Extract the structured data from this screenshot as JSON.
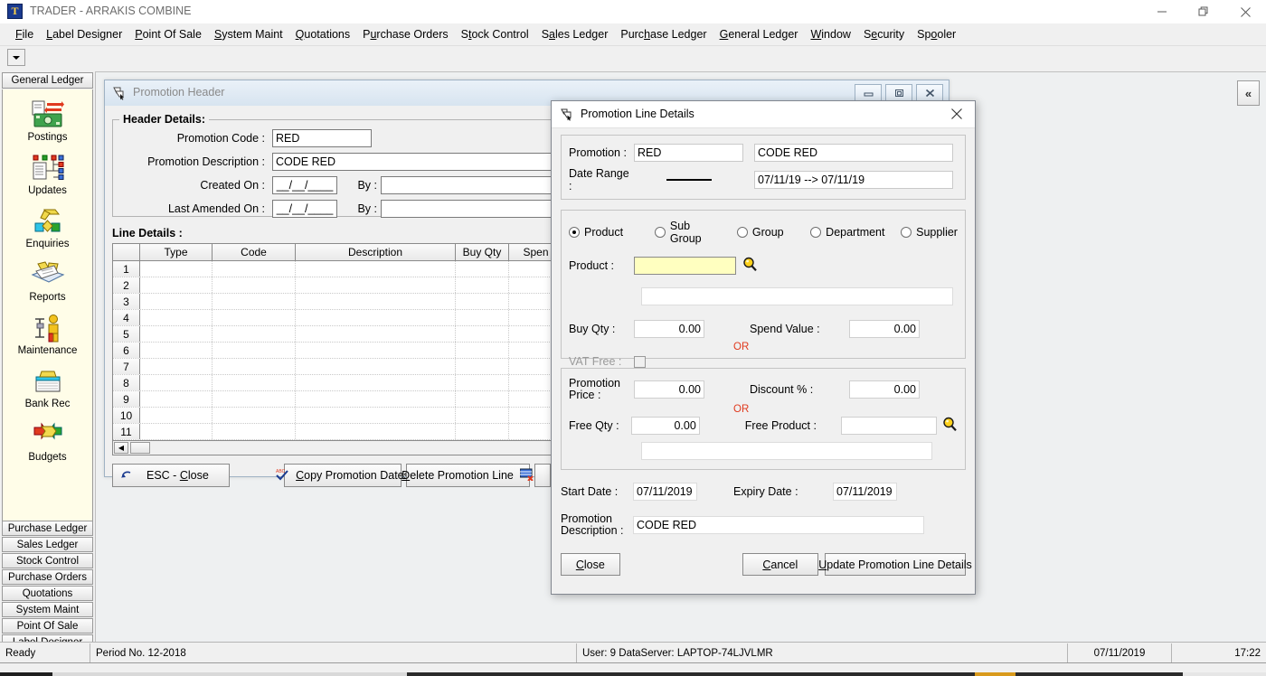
{
  "window": {
    "title": "TRADER - ARRAKIS COMBINE",
    "icon": "trader-app-icon",
    "minimize": "minimize-icon",
    "maximize": "restore-icon",
    "close": "close-icon"
  },
  "menubar": {
    "items": [
      {
        "label": "File",
        "accel": "F"
      },
      {
        "label": "Label Designer",
        "accel": "L"
      },
      {
        "label": "Point Of Sale",
        "accel": "P"
      },
      {
        "label": "System Maint",
        "accel": "S"
      },
      {
        "label": "Quotations",
        "accel": "Q"
      },
      {
        "label": "Purchase Orders",
        "accel": "u"
      },
      {
        "label": "Stock Control",
        "accel": "t"
      },
      {
        "label": "Sales Ledger",
        "accel": "a"
      },
      {
        "label": "Purchase Ledger",
        "accel": "h"
      },
      {
        "label": "General Ledger",
        "accel": "G"
      },
      {
        "label": "Window",
        "accel": "W"
      },
      {
        "label": "Security",
        "accel": "e"
      },
      {
        "label": "Spooler",
        "accel": "o"
      }
    ]
  },
  "sidebar": {
    "active_tab": "General Ledger",
    "entries": [
      {
        "label": "Postings",
        "icon": "postings-icon"
      },
      {
        "label": "Updates",
        "icon": "updates-icon"
      },
      {
        "label": "Enquiries",
        "icon": "enquiries-icon"
      },
      {
        "label": "Reports",
        "icon": "reports-icon"
      },
      {
        "label": "Maintenance",
        "icon": "maintenance-icon"
      },
      {
        "label": "Bank Rec",
        "icon": "bank-rec-icon"
      },
      {
        "label": "Budgets",
        "icon": "budgets-icon"
      }
    ],
    "bottom_tabs": [
      "Purchase Ledger",
      "Sales Ledger",
      "Stock Control",
      "Purchase Orders",
      "Quotations",
      "System Maint",
      "Point Of Sale",
      "Label Designer"
    ]
  },
  "mdi": {
    "collapse_label": "«"
  },
  "promotion_header_window": {
    "title": "Promotion Header",
    "icon": "promotion-header-icon",
    "buttons": {
      "minimize": "minimize-icon",
      "restore": "restore-icon",
      "close": "close-icon"
    },
    "header_details": {
      "legend": "Header Details:",
      "fields": [
        {
          "label": "Promotion Code :",
          "value": "RED"
        },
        {
          "label": "Promotion Description :",
          "value": "CODE RED"
        },
        {
          "label": "Created On :",
          "value": "__/__/____",
          "by_label": "By :",
          "by_value": ""
        },
        {
          "label": "Last Amended On :",
          "value": "__/__/____",
          "by_label": "By :",
          "by_value": ""
        }
      ]
    },
    "line_details": {
      "legend": "Line Details :",
      "columns": [
        "",
        "Type",
        "Code",
        "Description",
        "Buy Qty",
        "Spen"
      ],
      "rows": [
        "1",
        "2",
        "3",
        "4",
        "5",
        "6",
        "7",
        "8",
        "9",
        "10",
        "11"
      ]
    },
    "footer_buttons": [
      {
        "label": "ESC - Close",
        "accel": "C",
        "icon": "undo-arrow-icon"
      },
      {
        "label": "Copy Promotion Dates",
        "accel": "C",
        "icon": "spellcheck-icon"
      },
      {
        "label": "Delete Promotion Line",
        "accel": "D",
        "icon": "delete-row-icon"
      }
    ]
  },
  "dialog": {
    "title": "Promotion Line Details",
    "icon": "promotion-line-icon",
    "close_icon": "close-icon",
    "promotion": {
      "label": "Promotion :",
      "code": "RED",
      "description": "CODE RED"
    },
    "date_range": {
      "label": "Date Range :",
      "separator": "————",
      "value": "07/11/19  -->  07/11/19"
    },
    "target_type": {
      "options": [
        {
          "label": "Product",
          "selected": true
        },
        {
          "label": "Sub Group",
          "selected": false
        },
        {
          "label": "Group",
          "selected": false
        },
        {
          "label": "Department",
          "selected": false
        },
        {
          "label": "Supplier",
          "selected": false
        }
      ]
    },
    "product": {
      "label": "Product :",
      "value": "",
      "focused": true,
      "lookup_icon": "magnifier-icon",
      "description": ""
    },
    "buy_qty": {
      "label": "Buy Qty :",
      "value": "0.00"
    },
    "spend_value": {
      "label": "Spend Value :",
      "value": "0.00"
    },
    "or_label": "OR",
    "vat_free": {
      "label": "VAT Free :",
      "checked": false,
      "disabled": true
    },
    "promotion_price": {
      "label": "Promotion\nPrice :",
      "label_line1": "Promotion",
      "label_line2": "Price :",
      "value": "0.00"
    },
    "discount_pct": {
      "label": "Discount % :",
      "value": "0.00"
    },
    "free_qty": {
      "label": "Free Qty :",
      "value": "0.00"
    },
    "free_product": {
      "label": "Free Product :",
      "value": "",
      "lookup_icon": "magnifier-icon",
      "description": ""
    },
    "start_date": {
      "label": "Start Date :",
      "value": "07/11/2019"
    },
    "expiry_date": {
      "label": "Expiry Date :",
      "value": "07/11/2019"
    },
    "promotion_description": {
      "label_line1": "Promotion",
      "label_line2": "Description :",
      "value": "CODE RED"
    },
    "buttons": [
      {
        "label": "Close",
        "accel": "C",
        "name": "close-button"
      },
      {
        "label": "Cancel",
        "accel": "C",
        "name": "cancel-button"
      },
      {
        "label": "Update Promotion Line Details",
        "accel": "U",
        "name": "update-promotion-line-details-button"
      }
    ]
  },
  "statusbar": {
    "ready": "Ready",
    "period": "Period No. 12-2018",
    "user_server": "User: 9  DataServer: LAPTOP-74LJVLMR",
    "date": "07/11/2019",
    "time": "17:22"
  },
  "colors": {
    "focus_field": "#ffffc0",
    "or_red": "#e03a1e",
    "sidebar_bg": "#fffde8",
    "dialog_bg": "#f0f0f0"
  }
}
